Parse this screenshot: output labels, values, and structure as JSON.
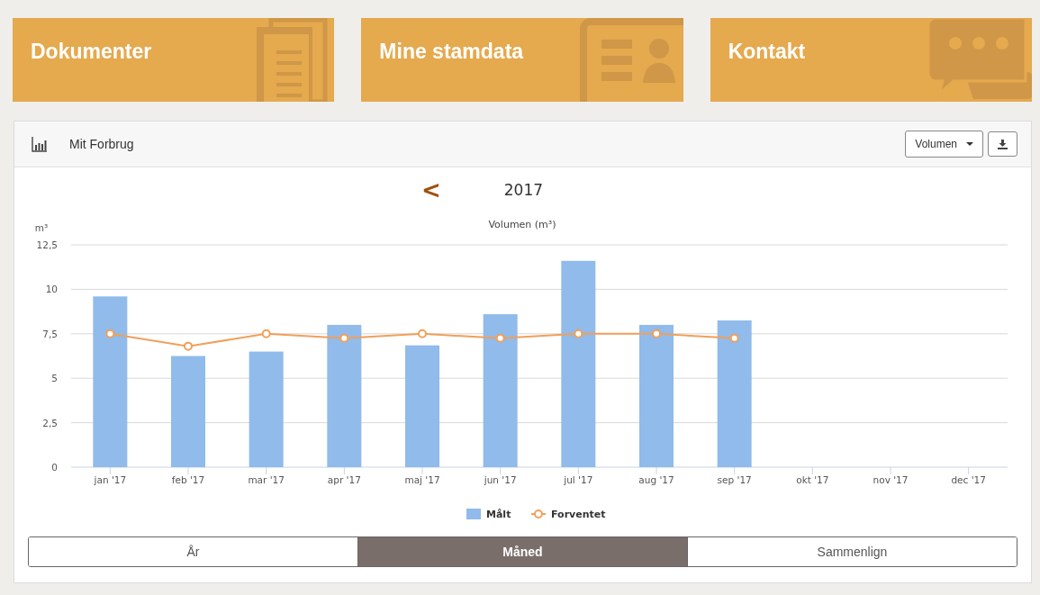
{
  "tiles": [
    {
      "label": "Dokumenter",
      "kind": "documents"
    },
    {
      "label": "Mine stamdata",
      "kind": "idcard"
    },
    {
      "label": "Kontakt",
      "kind": "chat"
    }
  ],
  "panel": {
    "title": "Mit Forbrug",
    "dropdown": {
      "value": "Volumen"
    },
    "year": "2017",
    "prev": "<",
    "chart_data": {
      "type": "bar",
      "title": "Volumen (m³)",
      "ylabel": "m³",
      "categories": [
        "jan '17",
        "feb '17",
        "mar '17",
        "apr '17",
        "maj '17",
        "jun '17",
        "jul '17",
        "aug '17",
        "sep '17",
        "okt '17",
        "nov '17",
        "dec '17"
      ],
      "ylim": [
        0,
        12.5
      ],
      "grid": true,
      "legend": "bottom",
      "yticks": [
        {
          "value": 0,
          "label": "0"
        },
        {
          "value": 2.5,
          "label": "2,5"
        },
        {
          "value": 5,
          "label": "5"
        },
        {
          "value": 7.5,
          "label": "7,5"
        },
        {
          "value": 10,
          "label": "10"
        },
        {
          "value": 12.5,
          "label": "12,5"
        }
      ],
      "series": [
        {
          "name": "Målt",
          "type": "bar",
          "color": "#90bbea",
          "values": [
            9.6,
            6.25,
            6.5,
            8.0,
            6.85,
            8.6,
            11.6,
            8.0,
            8.25,
            null,
            null,
            null
          ]
        },
        {
          "name": "Forventet",
          "type": "line",
          "marker": "circle",
          "color": "#f0a05a",
          "values": [
            7.5,
            6.8,
            7.5,
            7.25,
            7.5,
            7.25,
            7.5,
            7.5,
            7.25,
            null,
            null,
            null
          ]
        }
      ]
    },
    "tabs": [
      {
        "label": "År",
        "selected": false
      },
      {
        "label": "Måned",
        "selected": true
      },
      {
        "label": "Sammenlign",
        "selected": false
      }
    ]
  }
}
